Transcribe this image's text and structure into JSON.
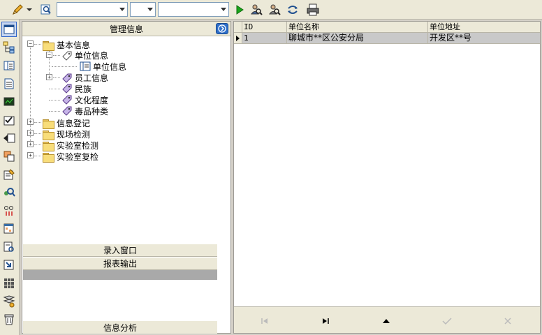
{
  "toolbar": {
    "combo1_value": "",
    "combo2_value": "",
    "combo3_value": ""
  },
  "panel": {
    "title": "管理信息",
    "tree": [
      {
        "label": "基本信息"
      },
      {
        "label": "单位信息"
      },
      {
        "label": "单位信息"
      },
      {
        "label": "员工信息"
      },
      {
        "label": "民族"
      },
      {
        "label": "文化程度"
      },
      {
        "label": "毒品种类"
      },
      {
        "label": "信息登记"
      },
      {
        "label": "现场检测"
      },
      {
        "label": "实验室检测"
      },
      {
        "label": "实验室复检"
      }
    ],
    "bars": {
      "entry": "录入窗口",
      "report": "报表输出",
      "analysis": "信息分析"
    }
  },
  "grid": {
    "columns": [
      "ID",
      "单位名称",
      "单位地址"
    ],
    "rows": [
      [
        "1",
        "聊城市**区公安分局",
        "开发区**号"
      ]
    ]
  },
  "icons": {
    "edit": "pencil-icon",
    "search": "search-icon",
    "run": "play-icon",
    "find_user": "find-user-icon",
    "refresh": "refresh-icon",
    "print": "print-icon"
  }
}
